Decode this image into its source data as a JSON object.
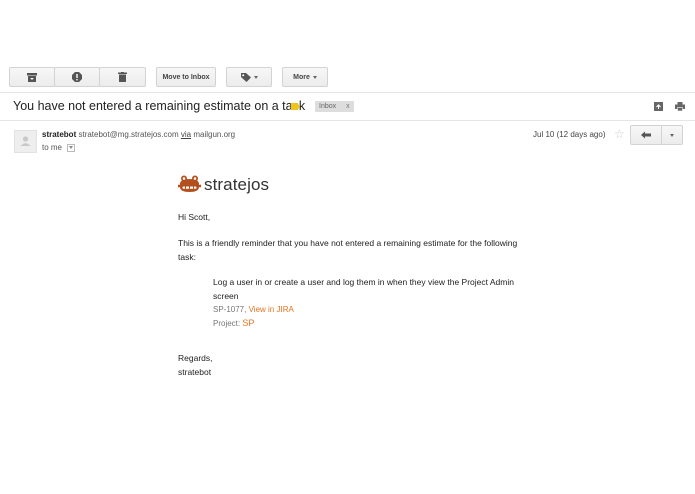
{
  "toolbar": {
    "move_to_inbox_label": "Move to Inbox",
    "more_label": "More"
  },
  "message": {
    "subject": "You have not entered a remaining estimate on a task",
    "labels": [
      {
        "name": "Inbox",
        "remove": "x"
      }
    ],
    "sender_name": "stratebot",
    "sender_email": "stratebot@mg.stratejos.com",
    "via_label": "via",
    "via_domain": "mailgun.org",
    "recipient": "to me",
    "date": "Jul 10 (12 days ago)"
  },
  "email_body": {
    "brand_name": "stratejos",
    "greeting": "Hi Scott,",
    "intro_line1": "This is a friendly reminder that you have not entered a remaining estimate for the following",
    "intro_line2": "task:",
    "task_line1": "Log a user in or create a user and log them in when they view the Project Admin",
    "task_line2": "screen",
    "issue_key": "SP-1077",
    "issue_sep": ",",
    "view_link": "View in JIRA",
    "project_label": "Project:",
    "project_key": "SP",
    "closing": "Regards,",
    "signature": "stratebot"
  },
  "colors": {
    "accent": "#e8731d",
    "label_yellow": "#f0c419",
    "chip_bg": "#dddddd"
  }
}
